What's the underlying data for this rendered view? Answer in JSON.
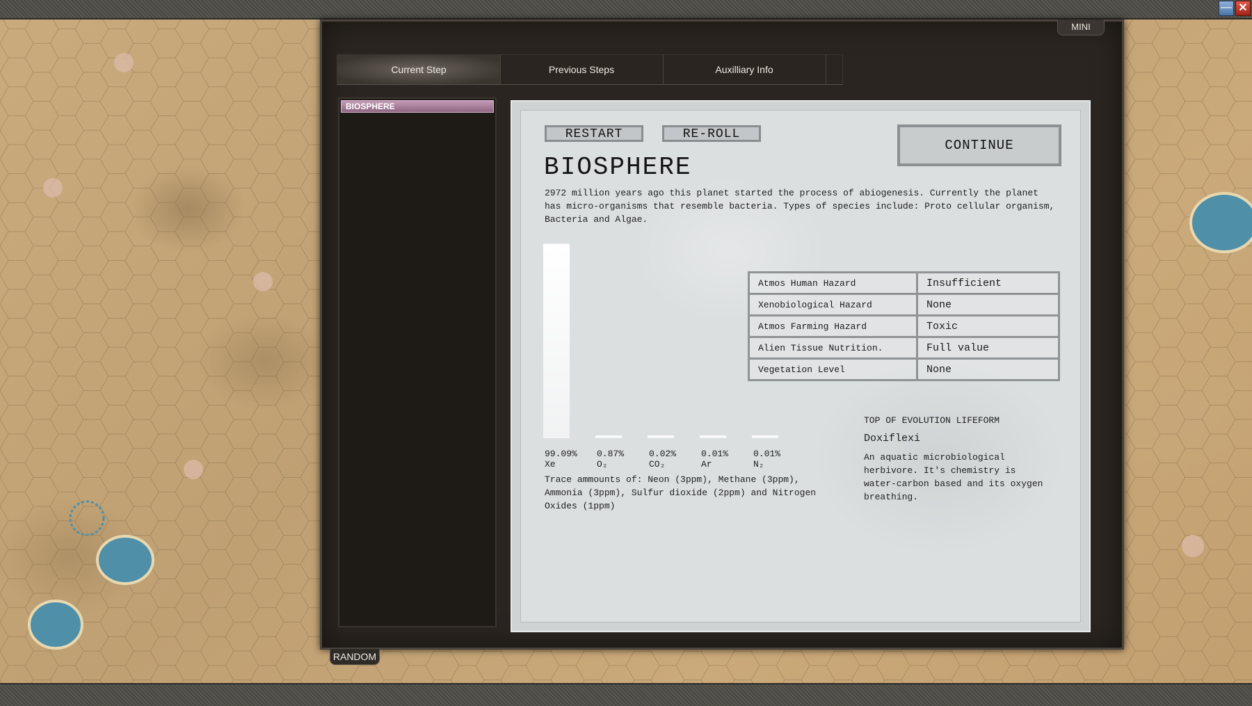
{
  "window": {
    "minimize_label": "—",
    "close_label": "✕"
  },
  "panel": {
    "mini_label": "MINI",
    "random_label": "RANDOM",
    "tabs": [
      {
        "label": "Current Step"
      },
      {
        "label": "Previous Steps"
      },
      {
        "label": "Auxilliary Info"
      }
    ],
    "steps": [
      {
        "label": "BIOSPHERE"
      }
    ]
  },
  "content": {
    "restart_label": "RESTART",
    "reroll_label": "RE-ROLL",
    "continue_label": "CONTINUE",
    "title": "BIOSPHERE",
    "description": "2972 million years ago this planet started the process of abiogenesis. Currently the planet has micro-organisms that resemble bacteria. Types of species include: Proto cellular organism, Bacteria and Algae.",
    "trace": "Trace ammounts of: Neon (3ppm), Methane (3ppm), Ammonia (3ppm), Sulfur dioxide (2ppm) and Nitrogen Oxides (1ppm)",
    "hazards": [
      {
        "label": "Atmos Human Hazard",
        "value": "Insufficient"
      },
      {
        "label": "Xenobiological Hazard",
        "value": "None"
      },
      {
        "label": "Atmos Farming Hazard",
        "value": "Toxic"
      },
      {
        "label": "Alien Tissue Nutrition.",
        "value": "Full value"
      },
      {
        "label": "Vegetation Level",
        "value": "None"
      }
    ],
    "lifeform": {
      "heading": "TOP OF EVOLUTION LIFEFORM",
      "name": "Doxiflexi",
      "description": "An aquatic microbiological herbivore. It's chemistry is water-carbon based and its oxygen breathing."
    }
  },
  "chart_data": {
    "type": "bar",
    "categories": [
      "Xe",
      "O₂",
      "CO₂",
      "Ar",
      "N₂"
    ],
    "values": [
      99.09,
      0.87,
      0.02,
      0.01,
      0.01
    ],
    "value_labels": [
      "99.09%",
      "0.87%",
      "0.02%",
      "0.01%",
      "0.01%"
    ],
    "ylim": [
      0,
      100
    ],
    "grid": false,
    "bar_color": "#ffffff"
  }
}
